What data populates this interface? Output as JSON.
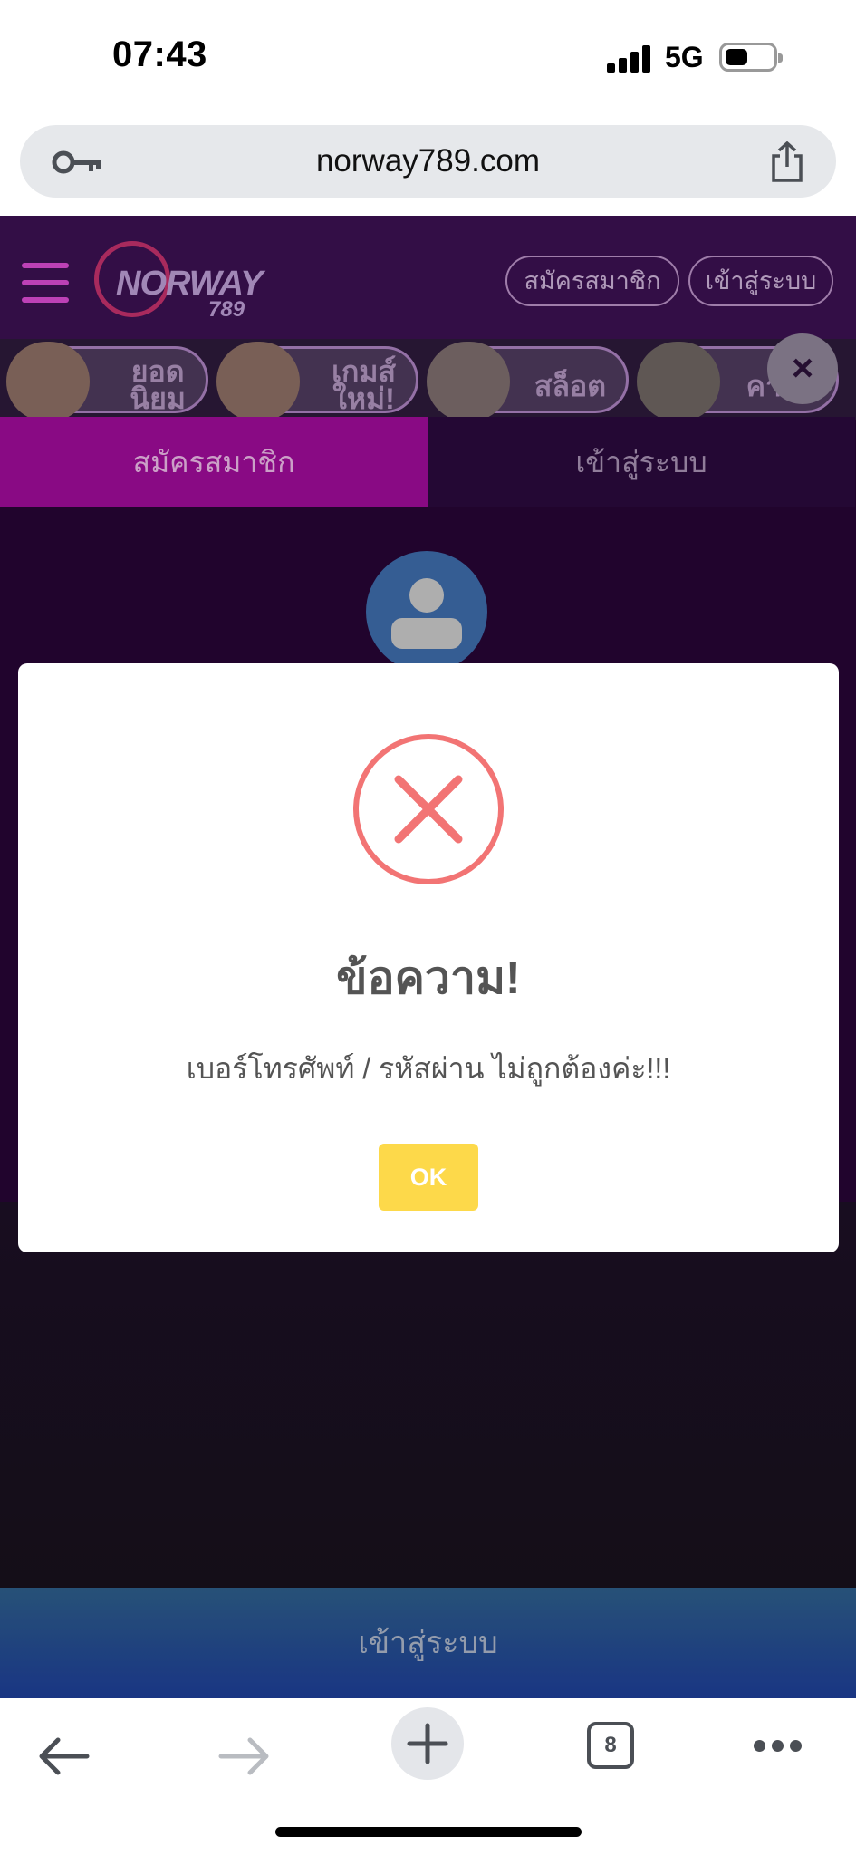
{
  "status_bar": {
    "time": "07:43",
    "network": "5G"
  },
  "browser": {
    "url": "norway789.com",
    "tab_count": "8"
  },
  "site": {
    "logo_text": "NORWAY",
    "logo_number": "789",
    "header_buttons": {
      "register": "สมัครสมาชิก",
      "login": "เข้าสู่ระบบ"
    },
    "categories": [
      {
        "label_line1": "ยอด",
        "label_line2": "นิยม"
      },
      {
        "label_line1": "เกมส์",
        "label_line2": "ใหม่!"
      },
      {
        "label_line1": "สล็อต",
        "label_line2": ""
      },
      {
        "label_line1": "คา",
        "label_line2": ""
      }
    ],
    "close_symbol": "×",
    "tabs": {
      "register": "สมัครสมาชิก",
      "login": "เข้าสู่ระบบ"
    },
    "login_button": "เข้าสู่ระบบ"
  },
  "modal": {
    "title": "ข้อความ!",
    "message": "เบอร์โทรศัพท์ / รหัสผ่าน ไม่ถูกต้องค่ะ!!!",
    "ok_label": "OK",
    "icon": "error-x-icon",
    "icon_color": "#f27474",
    "button_color": "#fdd94a"
  }
}
